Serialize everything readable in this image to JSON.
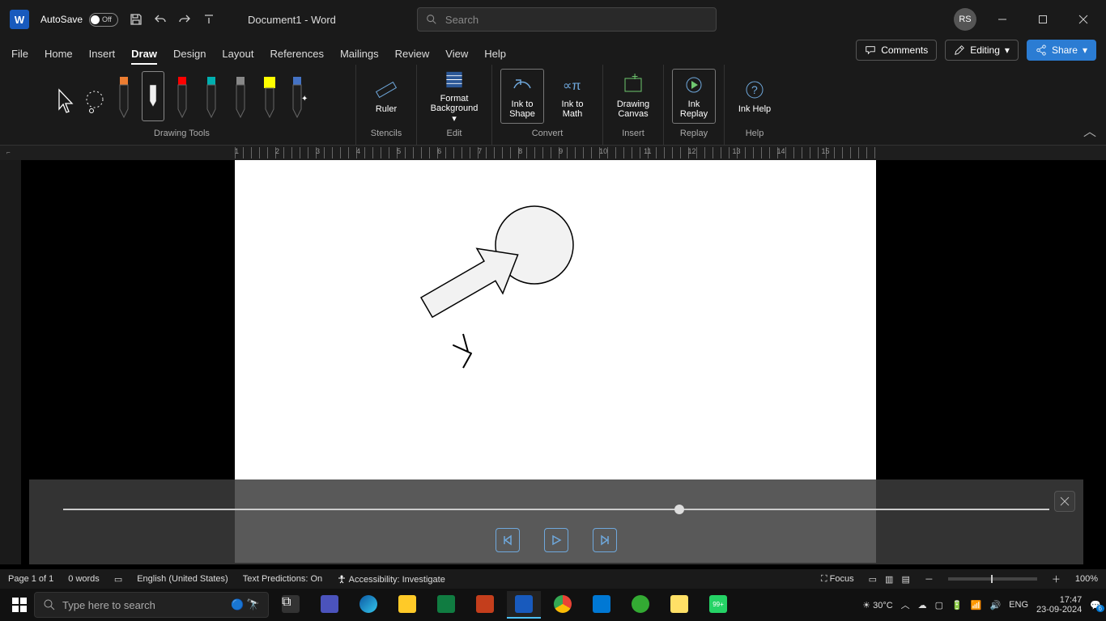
{
  "title_bar": {
    "autosave_label": "AutoSave",
    "autosave_state": "Off",
    "document_title": "Document1  -  Word",
    "search_placeholder": "Search",
    "avatar_initials": "RS"
  },
  "ribbon": {
    "tabs": [
      "File",
      "Home",
      "Insert",
      "Draw",
      "Design",
      "Layout",
      "References",
      "Mailings",
      "Review",
      "View",
      "Help"
    ],
    "active_tab": "Draw",
    "comments_label": "Comments",
    "editing_label": "Editing",
    "share_label": "Share",
    "groups": {
      "drawing_tools": {
        "label": "Drawing Tools",
        "pens": [
          {
            "name": "arrow-select",
            "color": "#ffffff"
          },
          {
            "name": "lasso",
            "color": "#ffffff"
          },
          {
            "name": "pen-orange",
            "color": "#ed7d31"
          },
          {
            "name": "pen-black-active",
            "color": "#000000"
          },
          {
            "name": "pen-red",
            "color": "#ff0000"
          },
          {
            "name": "pen-teal",
            "color": "#00b0b0"
          },
          {
            "name": "pencil-gray",
            "color": "#888888"
          },
          {
            "name": "highlighter-yellow",
            "color": "#ffff00"
          },
          {
            "name": "pen-sparkle",
            "color": "#4472c4"
          }
        ]
      },
      "stencils": {
        "label": "Stencils",
        "ruler": "Ruler"
      },
      "edit": {
        "label": "Edit",
        "format_bg": "Format Background"
      },
      "convert": {
        "label": "Convert",
        "ink_to_shape": "Ink to Shape",
        "ink_to_math": "Ink to Math"
      },
      "insert": {
        "label": "Insert",
        "drawing_canvas": "Drawing Canvas"
      },
      "replay": {
        "label": "Replay",
        "ink_replay": "Ink Replay"
      },
      "help": {
        "label": "Help",
        "ink_help": "Ink Help"
      }
    }
  },
  "ruler_numbers": [
    "1",
    "2",
    "3",
    "4",
    "5",
    "6",
    "7",
    "8",
    "9",
    "10",
    "11",
    "12",
    "13",
    "14",
    "15"
  ],
  "replay_pane": {
    "progress_percent": 62
  },
  "status_bar": {
    "page": "Page 1 of 1",
    "words": "0 words",
    "language": "English (United States)",
    "text_predictions": "Text Predictions: On",
    "accessibility": "Accessibility: Investigate",
    "focus": "Focus",
    "zoom": "100%"
  },
  "taskbar": {
    "search_placeholder": "Type here to search",
    "weather": "30°C",
    "language_code": "ENG",
    "time": "17:47",
    "date": "23-09-2024",
    "whatsapp_badge": "99+",
    "notification_badge": "6"
  }
}
